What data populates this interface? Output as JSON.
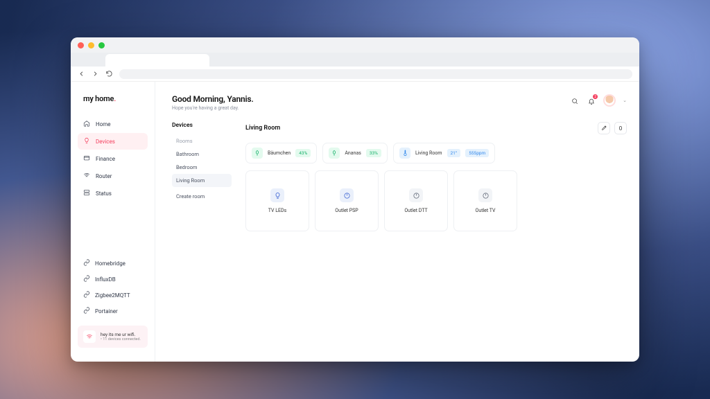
{
  "brand": {
    "name": "my home",
    "dot": "."
  },
  "nav": {
    "items": [
      {
        "label": "Home"
      },
      {
        "label": "Devices"
      },
      {
        "label": "Finance"
      },
      {
        "label": "Router"
      },
      {
        "label": "Status"
      }
    ]
  },
  "links": {
    "items": [
      {
        "label": "Homebridge"
      },
      {
        "label": "InfluxDB"
      },
      {
        "label": "Zigbee2MQTT"
      },
      {
        "label": "Portainer"
      }
    ]
  },
  "wifi": {
    "title": "hey its me ur wifi.",
    "subtitle": "• 11 devices connected."
  },
  "header": {
    "greeting": "Good Morning, Yannis.",
    "subtitle": "Hope you're having a great day.",
    "notif_count": "2"
  },
  "rooms": {
    "heading": "Devices",
    "list_label": "Rooms",
    "items": [
      {
        "label": "Bathroom"
      },
      {
        "label": "Bedroom"
      },
      {
        "label": "Living Room"
      }
    ],
    "create": "Create room"
  },
  "room": {
    "title": "Living Room",
    "count": "0"
  },
  "sensors": [
    {
      "name": "Bäumchen",
      "value": "43%",
      "kind": "plant"
    },
    {
      "name": "Ananas",
      "value": "33%",
      "kind": "plant"
    },
    {
      "name": "Living Room",
      "value": "21°",
      "value2": "555ppm",
      "kind": "climate"
    }
  ],
  "devices": [
    {
      "name": "TV LEDs",
      "icon": "bulb",
      "on": true
    },
    {
      "name": "Outlet PSP",
      "icon": "power",
      "on": true
    },
    {
      "name": "Outlet DTT",
      "icon": "power",
      "on": false
    },
    {
      "name": "Outlet TV",
      "icon": "power",
      "on": false
    }
  ]
}
